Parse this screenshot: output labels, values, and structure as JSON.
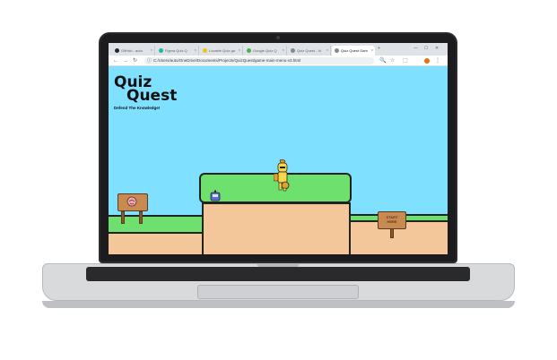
{
  "browser": {
    "tabs": [
      {
        "label": "GitHub - auto",
        "favicon_color": "#24292f"
      },
      {
        "label": "Figma Quiz Q",
        "favicon_color": "#1abc9c"
      },
      {
        "label": "Lovable Quiz ga",
        "favicon_color": "#f1c40f"
      },
      {
        "label": "Google Quiz Q",
        "favicon_color": "#4caf50"
      },
      {
        "label": "Quiz Quest - Vi",
        "favicon_color": "#7f8c8d"
      },
      {
        "label": "Quiz Quest Gam",
        "favicon_color": "#7f8c8d"
      }
    ],
    "url": "C:/Users/auto/OneDrive/Documents/Projects/QuizQuest/game-main-menu-v3.html",
    "icons": {
      "back": "←",
      "forward": "→",
      "reload": "↻",
      "info": "ⓘ",
      "zoom": "🔍",
      "star": "☆",
      "extensions": "⬚",
      "menu": "⋮",
      "minimize": "—",
      "maximize": "☐",
      "close": "✕",
      "tab_close": "×",
      "new_tab": "+"
    }
  },
  "game": {
    "logo": {
      "line1": "Quiz",
      "line2": "Quest",
      "tagline": "Defend The Knowledge!"
    },
    "start_sign": {
      "line1": "START",
      "line2": "HERE"
    },
    "colors": {
      "sky": "#7fe0ff",
      "grass": "#6ee06e",
      "dirt": "#f4c79a",
      "wood": "#c98a52"
    }
  }
}
